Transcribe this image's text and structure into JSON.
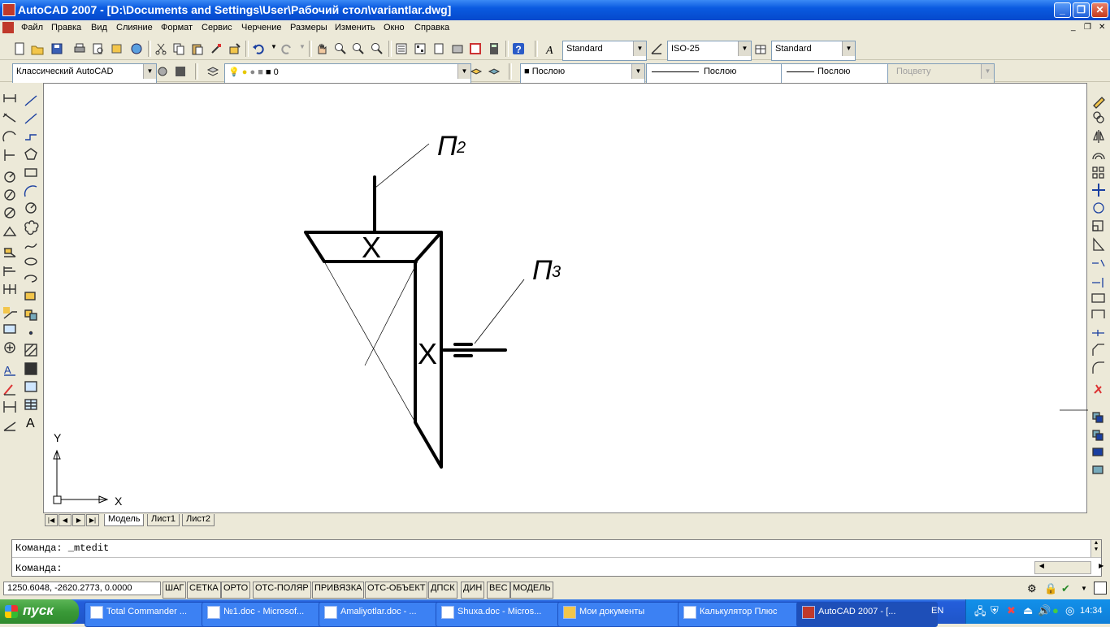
{
  "window": {
    "title": "AutoCAD 2007 - [D:\\Documents and Settings\\User\\Рабочий стол\\variantlar.dwg]"
  },
  "menu": [
    "Файл",
    "Правка",
    "Вид",
    "Слияние",
    "Формат",
    "Сервис",
    "Черчение",
    "Размеры",
    "Изменить",
    "Окно",
    "Справка"
  ],
  "toolbar1": {
    "text_style": "Standard",
    "dim_style": "ISO-25",
    "table_style": "Standard"
  },
  "toolbar2": {
    "workspace": "Классический AutoCAD",
    "layer": "0",
    "color": "Послою",
    "linetype": "Послою",
    "lineweight": "Послою",
    "plotstyle": "Поцвету"
  },
  "drawing": {
    "label_p2": "П2",
    "label_p3": "П3",
    "label_x1": "X",
    "label_x2": "X",
    "ucs_x": "X",
    "ucs_y": "Y"
  },
  "tabs": [
    "Модель",
    "Лист1",
    "Лист2"
  ],
  "command": {
    "history": "Команда:  _mtedit",
    "prompt": "Команда:"
  },
  "status": {
    "coords": "1250.6048, -2620.2773, 0.0000",
    "toggles": [
      "ШАГ",
      "СЕТКА",
      "ОРТО",
      "ОТС-ПОЛЯР",
      "ПРИВЯЗКА",
      "ОТС-ОБЪЕКТ",
      "ДПСК",
      "ДИН",
      "ВЕС",
      "МОДЕЛЬ"
    ]
  },
  "taskbar": {
    "start": "пуск",
    "tasks": [
      "Total Commander ...",
      "№1.doc - Microsof...",
      "Amaliyotlar.doc - ...",
      "Shuxa.doc - Micros...",
      "Мои документы",
      "Калькулятор Плюс",
      "AutoCAD 2007 - [..."
    ],
    "lang": "EN",
    "clock": "14:34"
  }
}
